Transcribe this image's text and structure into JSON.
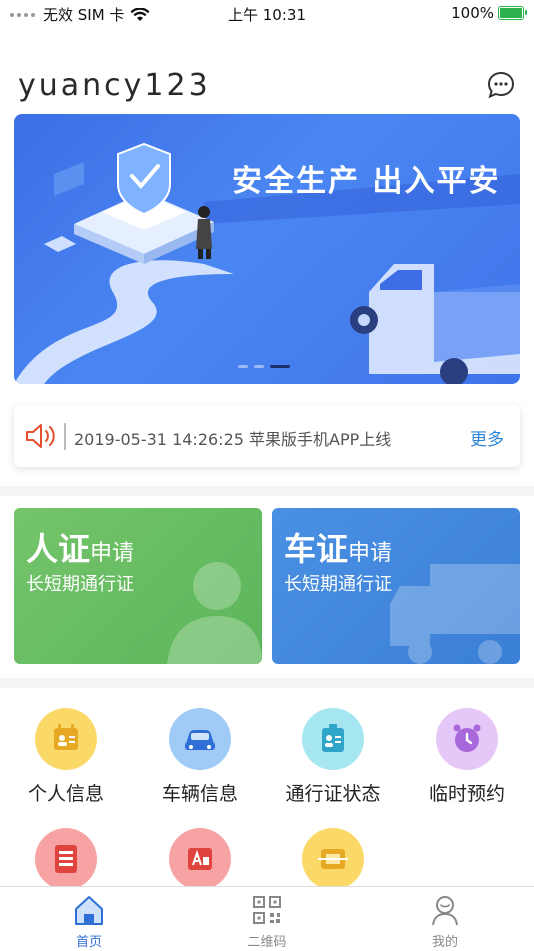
{
  "status_bar": {
    "carrier": "无效 SIM 卡",
    "time": "上午 10:31",
    "battery": "100%"
  },
  "header": {
    "username": "yuancy123"
  },
  "banner": {
    "slogan": "安全生产 出入平安",
    "active_page": 3,
    "total_pages": 3
  },
  "notice": {
    "text": "2019-05-31 14:26:25 苹果版手机APP上线",
    "more_label": "更多"
  },
  "cards": [
    {
      "big": "人证",
      "small": "申请",
      "sub": "长短期通行证"
    },
    {
      "big": "车证",
      "small": "申请",
      "sub": "长短期通行证"
    }
  ],
  "grid": [
    {
      "label": "个人信息",
      "icon": "id-card-icon",
      "color": "#fbd968"
    },
    {
      "label": "车辆信息",
      "icon": "car-icon",
      "color": "#9fcbf6"
    },
    {
      "label": "通行证状态",
      "icon": "badge-icon",
      "color": "#a6e6f0"
    },
    {
      "label": "临时预约",
      "icon": "alarm-clock-icon",
      "color": "#e5c8f7"
    },
    {
      "label": "",
      "icon": "document-icon",
      "color": "#f7a3a3"
    },
    {
      "label": "",
      "icon": "exam-icon",
      "color": "#f7a3a3"
    },
    {
      "label": "",
      "icon": "scan-icon",
      "color": "#fbd968"
    }
  ],
  "tabbar": {
    "tabs": [
      {
        "label": "首页",
        "icon": "home-icon",
        "active": true
      },
      {
        "label": "二维码",
        "icon": "qr-code-icon",
        "active": false
      },
      {
        "label": "我的",
        "icon": "profile-icon",
        "active": false
      }
    ],
    "active_color": "#2f6fd6",
    "inactive_color": "#888888"
  }
}
